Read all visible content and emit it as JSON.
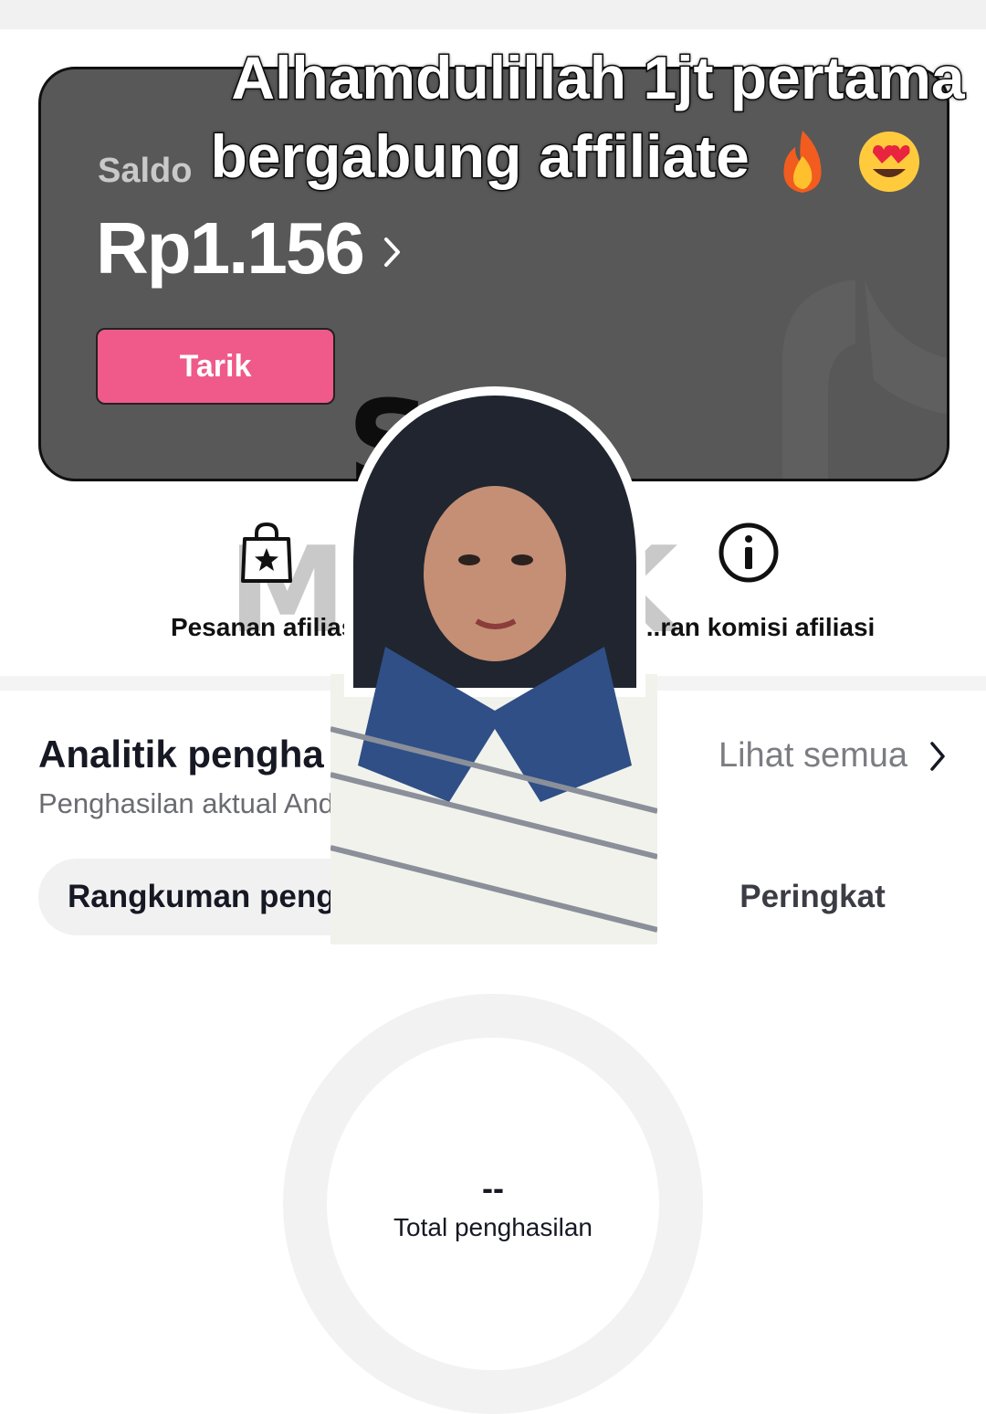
{
  "caption": {
    "line1": "Alhamdulillah 1jt pertama",
    "line2": "bergabung affiliate"
  },
  "balance_card": {
    "label": "Saldo",
    "amount": "Rp1.156",
    "withdraw_label": "Tarik"
  },
  "watermark": {
    "line1": "SA",
    "line2": "MA   AK"
  },
  "shortcuts": [
    {
      "label": "Pesanan afiliasi",
      "icon": "shopping-bag-star-icon"
    },
    {
      "label": "...ran komisi afiliasi",
      "icon": "info-icon"
    }
  ],
  "analytics": {
    "title": "Analitik pengha",
    "subtitle": "Penghasilan aktual And",
    "see_all_label": "Lihat semua",
    "tabs": [
      {
        "label": "Rangkuman peng",
        "selected": true
      },
      {
        "label": "Peringkat",
        "selected": false
      }
    ],
    "total_value": "--",
    "total_label": "Total penghasilan"
  },
  "colors": {
    "card_background": "#585858",
    "withdraw_button": "#ef5a8b",
    "muted_text": "#7c7d82"
  }
}
